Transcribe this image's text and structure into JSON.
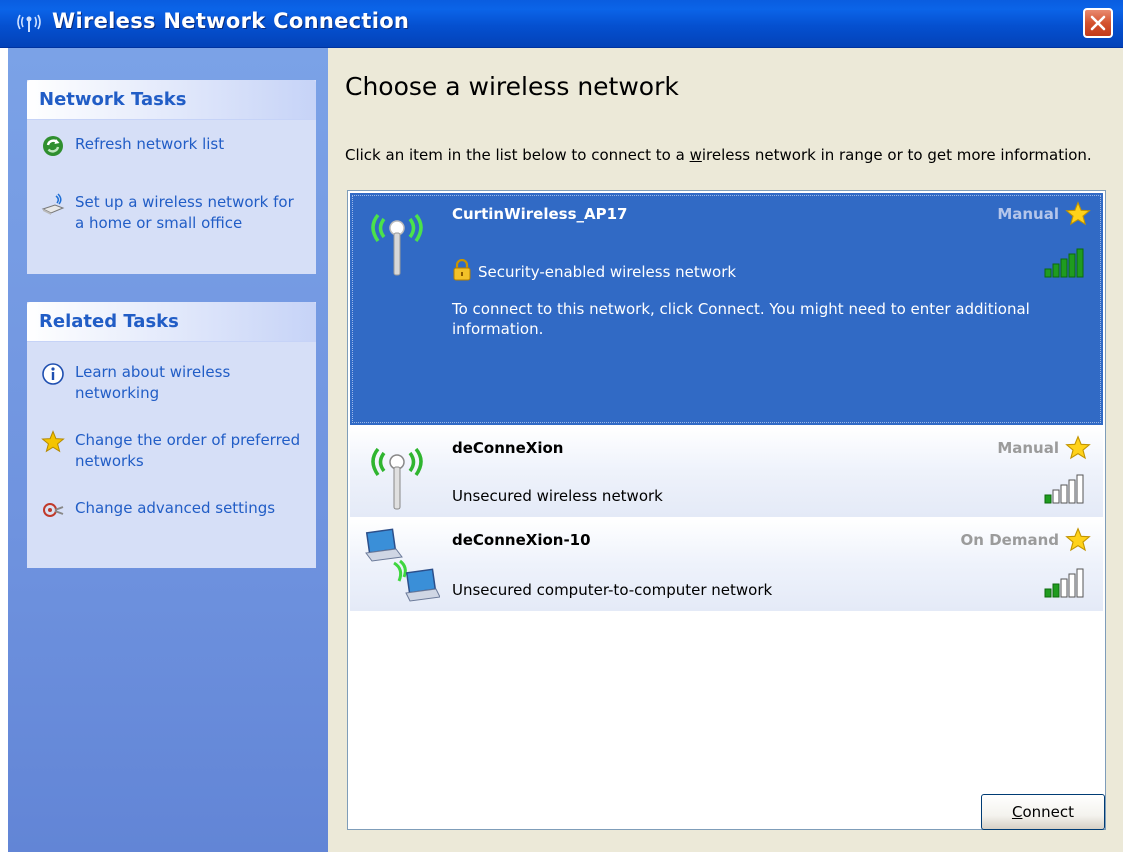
{
  "window": {
    "title": "Wireless Network Connection",
    "title_icon_glyph": "((ı))"
  },
  "sidebar": {
    "network_tasks": {
      "header": "Network Tasks",
      "items": [
        {
          "label": "Refresh network list",
          "icon": "refresh-icon"
        },
        {
          "label": "Set up a wireless network for a home or small office",
          "icon": "wireless-setup-icon"
        }
      ]
    },
    "related_tasks": {
      "header": "Related Tasks",
      "items": [
        {
          "label": "Learn about wireless networking",
          "icon": "info-icon"
        },
        {
          "label": "Change the order of preferred networks",
          "icon": "star-icon"
        },
        {
          "label": "Change advanced settings",
          "icon": "settings-icon"
        }
      ]
    }
  },
  "main": {
    "title": "Choose a wireless network",
    "instructions_pre": "Click an item in the list below to connect to a ",
    "instructions_underlined": "w",
    "instructions_post": "ireless network in range or to get more information.",
    "networks": [
      {
        "name": "CurtinWireless_AP17",
        "mode": "Manual",
        "status": "Security-enabled wireless network",
        "details": "To connect to this network, click Connect. You might need to enter additional information.",
        "selected": true,
        "signal_bars": 5,
        "type": "access-point"
      },
      {
        "name": "deConneXion",
        "mode": "Manual",
        "status": "Unsecured wireless network",
        "selected": false,
        "signal_bars": 1,
        "type": "access-point"
      },
      {
        "name": "deConneXion-10",
        "mode": "On Demand",
        "status": "Unsecured computer-to-computer network",
        "selected": false,
        "signal_bars": 2,
        "type": "ad-hoc"
      }
    ],
    "connect_label_underlined": "C",
    "connect_label_rest": "onnect"
  },
  "colors": {
    "titlebar": "#0550d0",
    "sidebar": "#6f93df",
    "selected_row": "#316ac5",
    "link": "#215dc6",
    "star": "#f5c400",
    "signal_green": "#1f9c1f"
  }
}
